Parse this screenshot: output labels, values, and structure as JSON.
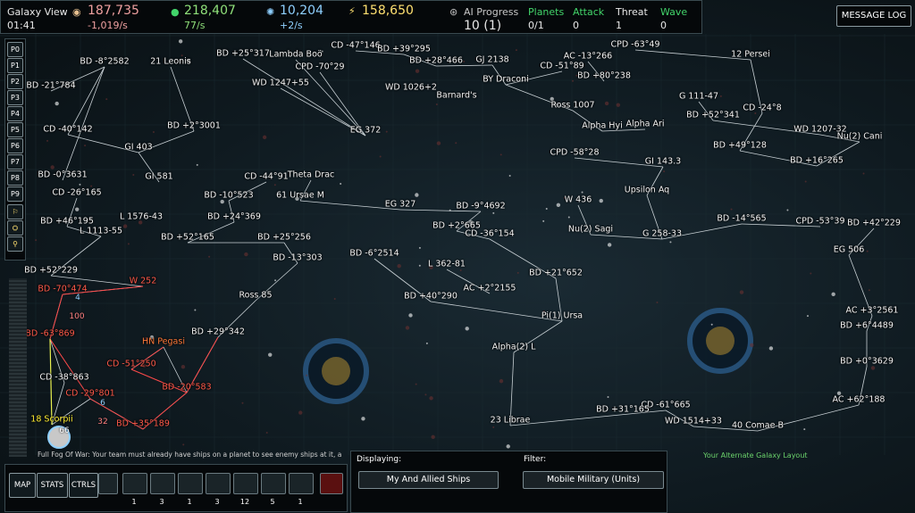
{
  "top": {
    "view": "Galaxy View",
    "time": "01:41",
    "metal": "187,735",
    "metal_rate": "-1,019/s",
    "crystal": "218,407",
    "crystal_rate": "77/s",
    "science": "10,204",
    "science_rate": "+2/s",
    "energy": "158,650",
    "ai_progress_label": "AI Progress",
    "ai_progress_value": "10 (1)",
    "planets_label": "Planets",
    "planets_value": "0/1",
    "attack_label": "Attack",
    "attack_value": "0",
    "threat_label": "Threat",
    "threat_value": "1",
    "wave_label": "Wave",
    "wave_value": "0"
  },
  "message_log": "MESSAGE LOG",
  "player_buttons": [
    "P0",
    "P1",
    "P2",
    "P3",
    "P4",
    "P5",
    "P6",
    "P7",
    "P8",
    "P9"
  ],
  "planets": [
    {
      "name": "BD -8°2582",
      "type": "normal"
    },
    {
      "name": "21 Leonis",
      "type": "normal"
    },
    {
      "name": "BD +25°317",
      "type": "normal"
    },
    {
      "name": "Lambda Boö",
      "type": "normal"
    },
    {
      "name": "CD -47°146",
      "type": "normal"
    },
    {
      "name": "BD +39°295",
      "type": "normal"
    },
    {
      "name": "BD +28°466",
      "type": "normal"
    },
    {
      "name": "GJ 2138",
      "type": "normal"
    },
    {
      "name": "AC -13°266",
      "type": "normal"
    },
    {
      "name": "CPD -63°49",
      "type": "normal"
    },
    {
      "name": "CD -51°89",
      "type": "normal"
    },
    {
      "name": "12 Persei",
      "type": "normal"
    },
    {
      "name": "BD -21°784",
      "type": "normal"
    },
    {
      "name": "CPD -70°29",
      "type": "normal"
    },
    {
      "name": "WD 1247+55",
      "type": "normal"
    },
    {
      "name": "WD 1026+2",
      "type": "normal"
    },
    {
      "name": "BY Draconi",
      "type": "normal"
    },
    {
      "name": "BD +80°238",
      "type": "normal"
    },
    {
      "name": "Barnard's",
      "type": "normal"
    },
    {
      "name": "G 111-47",
      "type": "normal"
    },
    {
      "name": "Ross 1007",
      "type": "normal"
    },
    {
      "name": "CD -24°8",
      "type": "normal"
    },
    {
      "name": "BD +52°341",
      "type": "normal"
    },
    {
      "name": "Alpha Hyi",
      "type": "normal"
    },
    {
      "name": "Alpha Ari",
      "type": "normal"
    },
    {
      "name": "BD +2°3001",
      "type": "normal"
    },
    {
      "name": "CD -40°142",
      "type": "normal"
    },
    {
      "name": "EG 372",
      "type": "normal"
    },
    {
      "name": "WD 1207-32",
      "type": "normal"
    },
    {
      "name": "Nu(2) Cani",
      "type": "normal"
    },
    {
      "name": "GI 403",
      "type": "normal"
    },
    {
      "name": "CPD -58°28",
      "type": "normal"
    },
    {
      "name": "BD +49°128",
      "type": "normal"
    },
    {
      "name": "BD +16°265",
      "type": "normal"
    },
    {
      "name": "GI 143.3",
      "type": "normal"
    },
    {
      "name": "Theta Drac",
      "type": "normal"
    },
    {
      "name": "CD -44°91",
      "type": "normal"
    },
    {
      "name": "BD -0°3631",
      "type": "normal"
    },
    {
      "name": "GI 581",
      "type": "normal"
    },
    {
      "name": "CD -26°165",
      "type": "normal"
    },
    {
      "name": "BD -10°523",
      "type": "normal"
    },
    {
      "name": "61 Ursae M",
      "type": "normal"
    },
    {
      "name": "Upsilon Aq",
      "type": "normal"
    },
    {
      "name": "W 436",
      "type": "normal"
    },
    {
      "name": "EG 327",
      "type": "normal"
    },
    {
      "name": "BD -9°4692",
      "type": "normal"
    },
    {
      "name": "L 1576-43",
      "type": "normal"
    },
    {
      "name": "BD +24°369",
      "type": "normal"
    },
    {
      "name": "BD +46°195",
      "type": "normal"
    },
    {
      "name": "BD +2°665",
      "type": "normal"
    },
    {
      "name": "BD -14°565",
      "type": "normal"
    },
    {
      "name": "CPD -53°39",
      "type": "normal"
    },
    {
      "name": "BD +42°229",
      "type": "normal"
    },
    {
      "name": "Nu(2) Sagi",
      "type": "normal"
    },
    {
      "name": "L 1113-55",
      "type": "normal"
    },
    {
      "name": "CD -36°154",
      "type": "normal"
    },
    {
      "name": "G 258-33",
      "type": "normal"
    },
    {
      "name": "BD +52°165",
      "type": "normal"
    },
    {
      "name": "BD +25°256",
      "type": "normal"
    },
    {
      "name": "EG 506",
      "type": "normal"
    },
    {
      "name": "BD -6°2514",
      "type": "normal"
    },
    {
      "name": "BD -13°303",
      "type": "normal"
    },
    {
      "name": "L 362-81",
      "type": "normal"
    },
    {
      "name": "BD +52°229",
      "type": "normal"
    },
    {
      "name": "BD +21°652",
      "type": "normal"
    },
    {
      "name": "W 252",
      "type": "hostile"
    },
    {
      "name": "BD -70°474",
      "type": "hostile"
    },
    {
      "name": "AC +2°2155",
      "type": "normal"
    },
    {
      "name": "BD +40°290",
      "type": "normal"
    },
    {
      "name": "Ross 85",
      "type": "normal"
    },
    {
      "name": "Pi(1) Ursa",
      "type": "normal"
    },
    {
      "name": "AC +3°2561",
      "type": "normal"
    },
    {
      "name": "BD +6°4489",
      "type": "normal"
    },
    {
      "name": "BD -63°869",
      "type": "hostile"
    },
    {
      "name": "BD +29°342",
      "type": "normal"
    },
    {
      "name": "HN Pegasi",
      "type": "orange"
    },
    {
      "name": "Alpha(2) L",
      "type": "normal"
    },
    {
      "name": "BD +0°3629",
      "type": "normal"
    },
    {
      "name": "CD -51°250",
      "type": "hostile"
    },
    {
      "name": "CD -38°863",
      "type": "normal"
    },
    {
      "name": "BD -20°583",
      "type": "hostile"
    },
    {
      "name": "AC +62°188",
      "type": "normal"
    },
    {
      "name": "CD -29°801",
      "type": "hostile"
    },
    {
      "name": "CD -61°665",
      "type": "normal"
    },
    {
      "name": "BD +31°165",
      "type": "normal"
    },
    {
      "name": "23 Librae",
      "type": "normal"
    },
    {
      "name": "WD 1514+33",
      "type": "normal"
    },
    {
      "name": "40 Comae B",
      "type": "normal"
    },
    {
      "name": "18 Scorpii",
      "type": "friendly"
    },
    {
      "name": "BD +35°189",
      "type": "hostile"
    }
  ],
  "badges": {
    "w252_count": "4",
    "w252_strength": "100",
    "cd29_count": "6",
    "cd29_strength": "32",
    "home_count": "66"
  },
  "fog_text": "Full Fog Of War: Your team must already have ships on a planet to see enemy ships at it, a",
  "alt_layout": "Your Alternate Galaxy Layout",
  "bottom": {
    "map_btn": "MAP",
    "stats_btn": "STATS",
    "ctrls_btn": "CTRLS",
    "ship_counts": [
      "1",
      "3",
      "1",
      "3",
      "12",
      "5",
      "1"
    ]
  },
  "displaying": {
    "label": "Displaying:",
    "value": "My And Allied Ships"
  },
  "filter": {
    "label": "Filter:",
    "value": "Mobile Military (Units)"
  },
  "colors": {
    "metal": "#f0a0a0",
    "crystal": "#8fe07a",
    "science": "#8fd0ff",
    "energy": "#ffe070",
    "green": "#42d46a",
    "hostile": "#ff3b3b",
    "friendly": "#ffee33"
  }
}
